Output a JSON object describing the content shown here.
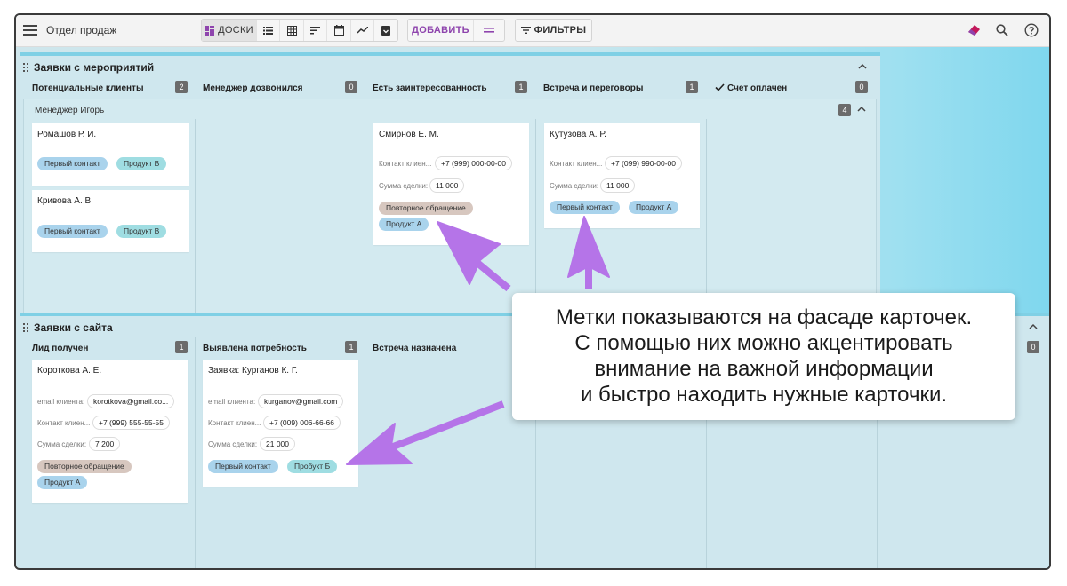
{
  "toolbar": {
    "title": "Отдел продаж",
    "boards_label": "ДОСКИ",
    "add_label": "ДОБАВИТЬ",
    "filters_label": "ФИЛЬТРЫ",
    "accent": "#8e44ad"
  },
  "panel1": {
    "title": "Заявки с мероприятий",
    "columns": [
      {
        "label": "Потенциальные клиенты",
        "count": "2"
      },
      {
        "label": "Менеджер дозвонился",
        "count": "0"
      },
      {
        "label": "Есть заинтересованность",
        "count": "1"
      },
      {
        "label": "Встреча и переговоры",
        "count": "1"
      },
      {
        "label": "Счет оплачен",
        "count": "0"
      }
    ],
    "lane": {
      "title": "Менеджер Игорь",
      "count": "4"
    },
    "cards": [
      {
        "name": "Ромашов Р. И.",
        "tags": [
          "Первый контакт",
          "Продукт В"
        ]
      },
      {
        "name": "Кривова А. В.",
        "tags": [
          "Первый контакт",
          "Продукт В"
        ]
      },
      {
        "name": "Смирнов Е. М.",
        "contact_label": "Контакт клиен...",
        "contact": "+7 (999) 000-00-00",
        "sum_label": "Сумма сделки:",
        "sum": "11 000",
        "tags": [
          "Повторное обращение",
          "Продукт А"
        ]
      },
      {
        "name": "Кутузова А. Р.",
        "contact_label": "Контакт клиен...",
        "contact": "+7 (099) 990-00-00",
        "sum_label": "Сумма сделки:",
        "sum": "11 000",
        "tags": [
          "Первый контакт",
          "Продукт А"
        ]
      }
    ]
  },
  "panel2": {
    "title": "Заявки с сайта",
    "columns": [
      {
        "label": "Лид получен",
        "count": "1"
      },
      {
        "label": "Выявлена потребность",
        "count": "1"
      },
      {
        "label": "Встреча назначена",
        "count": ""
      },
      {
        "label": "",
        "count": "0"
      }
    ],
    "cards": [
      {
        "name": "Короткова А. Е.",
        "email_label": "email клиента:",
        "email": "korotkova@gmail.co...",
        "contact_label": "Контакт клиен...",
        "contact": "+7 (999) 555-55-55",
        "sum_label": "Сумма сделки:",
        "sum": "7 200",
        "tags": [
          "Повторное обращение",
          "Продукт А"
        ]
      },
      {
        "name": "Заявка: Курганов К. Г.",
        "email_label": "email клиента:",
        "email": "kurganov@gmail.com",
        "contact_label": "Контакт клиен...",
        "contact": "+7 (009) 006-66-66",
        "sum_label": "Сумма сделки:",
        "sum": "21 000",
        "tags": [
          "Первый контакт",
          "Пробукт Б"
        ]
      }
    ]
  },
  "callout": {
    "line1": "Метки показываются на фасаде карточек.",
    "line2": "С помощью них можно акцентировать",
    "line3": "внимание на важной информации",
    "line4": "и быстро находить нужные карточки."
  },
  "icons": [
    "menu-icon",
    "board-icon",
    "list-icon",
    "table-icon",
    "sort-icon",
    "calendar-icon",
    "chart-icon",
    "archive-icon",
    "equals-icon",
    "filter-icon",
    "eraser-icon",
    "search-icon",
    "help-icon",
    "drag-icon",
    "chevron-up-icon",
    "check-icon",
    "arrow-icon"
  ]
}
